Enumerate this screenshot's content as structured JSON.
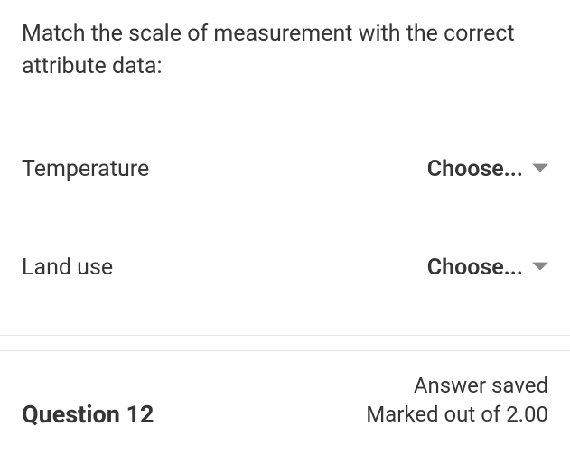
{
  "question": {
    "prompt": "Match the scale of measurement with the correct attribute data:",
    "rows": [
      {
        "label": "Temperature",
        "selected": "Choose..."
      },
      {
        "label": "Land use",
        "selected": "Choose..."
      }
    ]
  },
  "footer": {
    "question_label": "Question 12",
    "status_saved": "Answer saved",
    "status_marks": "Marked out of 2.00"
  }
}
